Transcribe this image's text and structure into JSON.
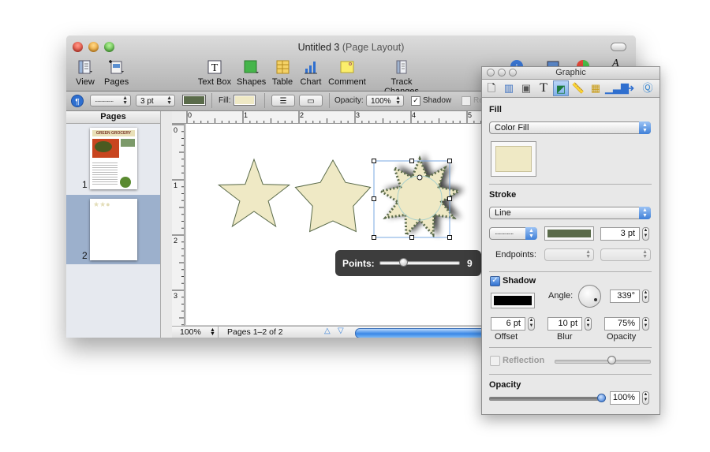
{
  "window": {
    "title": "Untitled 3",
    "subtitle": "(Page Layout)"
  },
  "toolbar": {
    "view_label": "View",
    "pages_label": "Pages",
    "textbox_label": "Text Box",
    "shapes_label": "Shapes",
    "table_label": "Table",
    "chart_label": "Chart",
    "comment_label": "Comment",
    "track_changes_label": "Track Changes"
  },
  "format_bar": {
    "line_style": "··············",
    "stroke_width": "3 pt",
    "stroke_color": "#5a6b4a",
    "fill_label": "Fill:",
    "fill_color": "#efe9c5",
    "opacity_label": "Opacity:",
    "opacity_value": "100%",
    "shadow_label": "Shadow",
    "shadow_checked": true,
    "reflection_label": "Re"
  },
  "pages_panel": {
    "header": "Pages",
    "items": [
      {
        "number": "1",
        "title": "GREEN GROCERY",
        "selected": false
      },
      {
        "number": "2",
        "selected": true
      }
    ]
  },
  "rulers": {
    "horizontal": [
      "0",
      "1",
      "2",
      "3",
      "4",
      "5"
    ],
    "vertical": [
      "0",
      "1",
      "2",
      "3"
    ]
  },
  "canvas": {
    "shapes": [
      {
        "type": "star",
        "points": 5,
        "name": "thin-star"
      },
      {
        "type": "star",
        "points": 5,
        "name": "fat-star"
      },
      {
        "type": "star",
        "points": 9,
        "name": "sun-star",
        "selected": true
      }
    ],
    "shape_fill": "#efe9c5",
    "shape_stroke": "#5a6b4a"
  },
  "points_hud": {
    "label": "Points:",
    "value": "9",
    "fraction": 0.3
  },
  "status_bar": {
    "zoom": "100%",
    "page_info": "Pages 1–2 of 2"
  },
  "inspector": {
    "title": "Graphic",
    "tabs": [
      "document",
      "layout",
      "wrap",
      "text",
      "graphic",
      "metrics",
      "table",
      "chart",
      "link",
      "quicktime"
    ],
    "selected_tab": "graphic",
    "fill": {
      "heading": "Fill",
      "type": "Color Fill",
      "color": "#efe9c5"
    },
    "stroke": {
      "heading": "Stroke",
      "type": "Line",
      "style": "··············",
      "color": "#5a6b4a",
      "width": "3 pt",
      "endpoints_label": "Endpoints:"
    },
    "shadow": {
      "heading": "Shadow",
      "checked": true,
      "color": "#000000",
      "angle_label": "Angle:",
      "angle": "339°",
      "offset": "6 pt",
      "offset_label": "Offset",
      "blur": "10 pt",
      "blur_label": "Blur",
      "opacity": "75%",
      "opacity_label": "Opacity"
    },
    "reflection": {
      "label": "Reflection",
      "checked": false,
      "fraction": 0.6
    },
    "opacity": {
      "heading": "Opacity",
      "value": "100%",
      "fraction": 1.0
    }
  }
}
